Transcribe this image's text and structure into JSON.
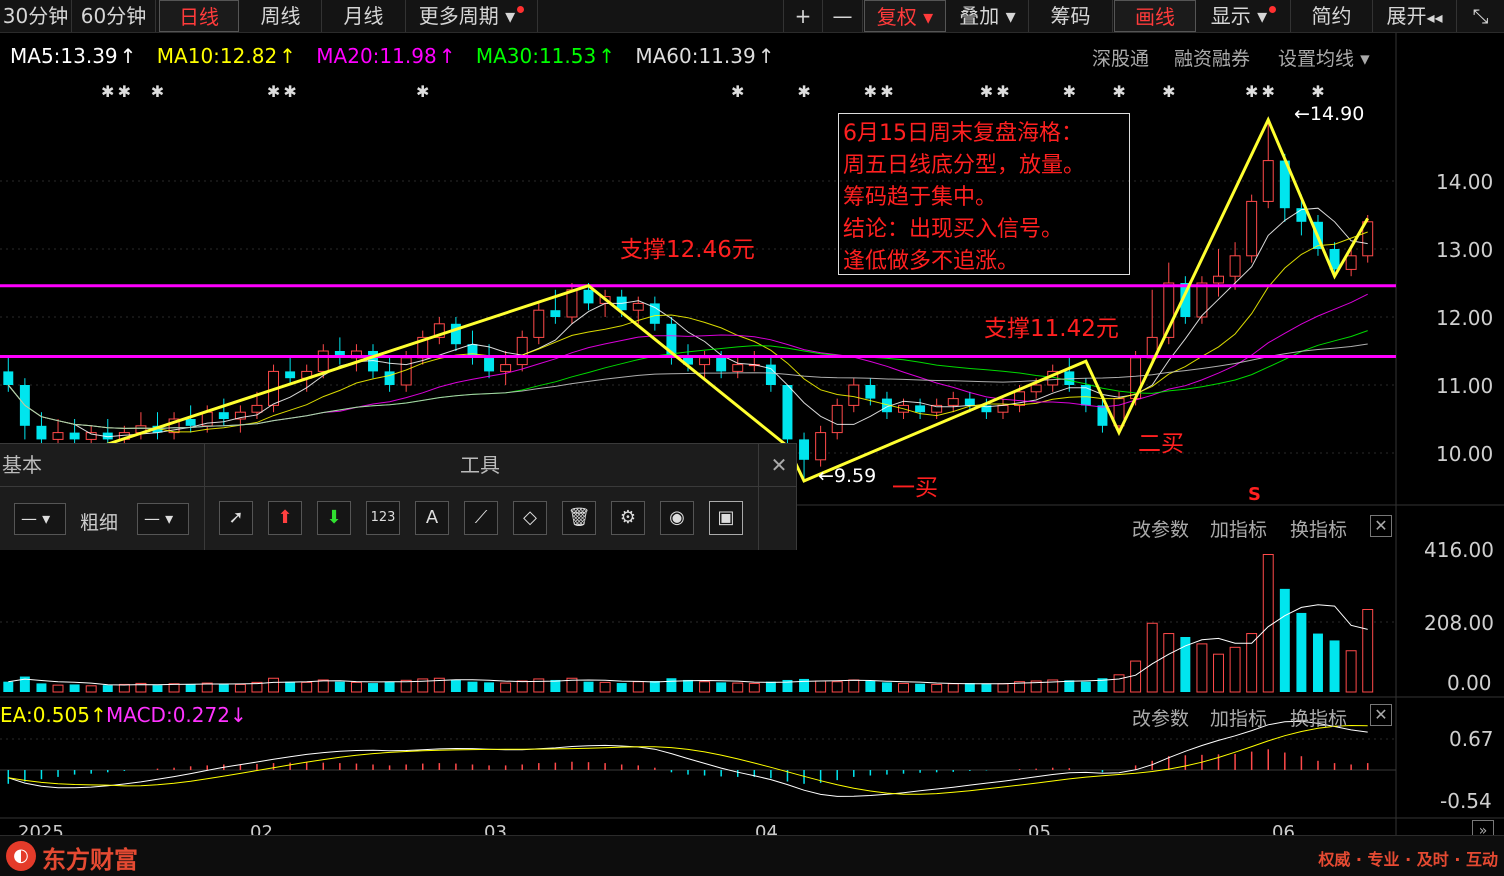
{
  "toolbar": {
    "periods": [
      "30分钟",
      "60分钟",
      "日线",
      "周线",
      "月线",
      "更多周期"
    ],
    "active_period": "日线",
    "right_buttons": [
      "+",
      "—",
      "复权",
      "叠加",
      "筹码",
      "画线",
      "显示",
      "简约",
      "展开"
    ],
    "restore_label": "复权",
    "draw_label": "画线"
  },
  "ma_indicators": [
    {
      "label": "MA5:13.39",
      "color": "#ffffff"
    },
    {
      "label": "MA10:12.82",
      "color": "#ffff00"
    },
    {
      "label": "MA20:11.98",
      "color": "#ff00ff"
    },
    {
      "label": "MA30:11.53",
      "color": "#00ff00"
    },
    {
      "label": "MA60:11.39",
      "color": "#dddddd"
    }
  ],
  "right_links": {
    "sgt": "深股通",
    "margin": "融资融券",
    "set_ma": "设置均线"
  },
  "annotations": {
    "note_lines": [
      "6月15日周末复盘海格：",
      "周五日线底分型，放量。",
      "筹码趋于集中。",
      "结论：出现买入信号。",
      "逢低做多不追涨。"
    ],
    "support1": "支撑12.46元",
    "support2": "支撑11.42元",
    "high_label": "14.90",
    "low_label": "9.59",
    "buy1": "一买",
    "buy2": "二买",
    "s_mark": "S"
  },
  "price_axis": [
    "14.00",
    "13.00",
    "12.00",
    "11.00",
    "10.00"
  ],
  "volume_axis": [
    "416.00",
    "208.00",
    "0.00"
  ],
  "macd_axis": [
    "0.67",
    "-0.54"
  ],
  "sub_panel_links": {
    "change_param": "改参数",
    "add_indicator": "加指标",
    "switch_indicator": "换指标"
  },
  "macd_labels": {
    "dea": "EA:0.505",
    "macd": "MACD:0.272"
  },
  "x_axis": [
    "2025",
    "02",
    "03",
    "04",
    "05",
    "06"
  ],
  "draw_panel": {
    "basic": "基本",
    "tools": "工具",
    "thickness": "粗细",
    "tool_icons": [
      "pointer-icon",
      "up-arrow-icon",
      "down-arrow-icon",
      "number-icon",
      "text-icon",
      "ruler-icon",
      "eraser-icon",
      "trash-icon",
      "gear-icon",
      "eye-icon",
      "image-icon"
    ]
  },
  "footer": {
    "brand": "东方财富",
    "slogan": "权威 · 专业 · 及时 · 互动"
  },
  "chart_data": {
    "type": "candlestick",
    "price_range": [
      9.4,
      15.2
    ],
    "support_levels": [
      12.46,
      11.42
    ],
    "key_points": {
      "high": 14.9,
      "low": 9.59
    },
    "candles": [
      [
        11.2,
        11.4,
        10.9,
        11.0
      ],
      [
        11.0,
        11.1,
        10.2,
        10.4
      ],
      [
        10.4,
        10.6,
        10.0,
        10.2
      ],
      [
        10.2,
        10.5,
        10.0,
        10.3
      ],
      [
        10.3,
        10.5,
        10.1,
        10.2
      ],
      [
        10.2,
        10.4,
        10.0,
        10.3
      ],
      [
        10.3,
        10.5,
        10.1,
        10.2
      ],
      [
        10.2,
        10.4,
        10.1,
        10.3
      ],
      [
        10.3,
        10.6,
        10.2,
        10.4
      ],
      [
        10.4,
        10.6,
        10.2,
        10.3
      ],
      [
        10.3,
        10.6,
        10.2,
        10.5
      ],
      [
        10.5,
        10.7,
        10.3,
        10.4
      ],
      [
        10.4,
        10.7,
        10.3,
        10.6
      ],
      [
        10.6,
        10.8,
        10.4,
        10.5
      ],
      [
        10.5,
        10.7,
        10.3,
        10.6
      ],
      [
        10.6,
        10.9,
        10.5,
        10.7
      ],
      [
        10.7,
        11.3,
        10.6,
        11.2
      ],
      [
        11.2,
        11.4,
        11.0,
        11.1
      ],
      [
        11.1,
        11.3,
        10.9,
        11.2
      ],
      [
        11.2,
        11.6,
        11.1,
        11.5
      ],
      [
        11.5,
        11.7,
        11.3,
        11.4
      ],
      [
        11.4,
        11.6,
        11.2,
        11.5
      ],
      [
        11.5,
        11.6,
        11.1,
        11.2
      ],
      [
        11.2,
        11.4,
        10.9,
        11.0
      ],
      [
        11.0,
        11.5,
        10.9,
        11.4
      ],
      [
        11.4,
        11.8,
        11.3,
        11.7
      ],
      [
        11.7,
        12.0,
        11.6,
        11.9
      ],
      [
        11.9,
        12.0,
        11.5,
        11.6
      ],
      [
        11.6,
        11.8,
        11.3,
        11.4
      ],
      [
        11.4,
        11.6,
        11.1,
        11.2
      ],
      [
        11.2,
        11.5,
        11.0,
        11.3
      ],
      [
        11.3,
        11.8,
        11.2,
        11.7
      ],
      [
        11.7,
        12.2,
        11.6,
        12.1
      ],
      [
        12.1,
        12.4,
        11.9,
        12.0
      ],
      [
        12.0,
        12.5,
        11.9,
        12.4
      ],
      [
        12.4,
        12.5,
        12.1,
        12.2
      ],
      [
        12.2,
        12.4,
        12.0,
        12.3
      ],
      [
        12.3,
        12.4,
        12.0,
        12.1
      ],
      [
        12.1,
        12.3,
        11.9,
        12.2
      ],
      [
        12.2,
        12.3,
        11.8,
        11.9
      ],
      [
        11.9,
        12.0,
        11.3,
        11.4
      ],
      [
        11.4,
        11.6,
        11.2,
        11.3
      ],
      [
        11.3,
        11.5,
        11.1,
        11.4
      ],
      [
        11.4,
        11.5,
        11.1,
        11.2
      ],
      [
        11.2,
        11.4,
        11.1,
        11.3
      ],
      [
        11.3,
        11.5,
        11.2,
        11.3
      ],
      [
        11.3,
        11.4,
        10.9,
        11.0
      ],
      [
        11.0,
        11.0,
        10.1,
        10.2
      ],
      [
        10.2,
        10.3,
        9.59,
        9.9
      ],
      [
        9.9,
        10.4,
        9.8,
        10.3
      ],
      [
        10.3,
        10.8,
        10.2,
        10.7
      ],
      [
        10.7,
        11.1,
        10.6,
        11.0
      ],
      [
        11.0,
        11.1,
        10.7,
        10.8
      ],
      [
        10.8,
        10.9,
        10.5,
        10.6
      ],
      [
        10.6,
        10.8,
        10.5,
        10.7
      ],
      [
        10.7,
        10.8,
        10.5,
        10.6
      ],
      [
        10.6,
        10.8,
        10.5,
        10.7
      ],
      [
        10.7,
        10.9,
        10.6,
        10.8
      ],
      [
        10.8,
        10.9,
        10.6,
        10.7
      ],
      [
        10.7,
        10.8,
        10.5,
        10.6
      ],
      [
        10.6,
        10.8,
        10.5,
        10.7
      ],
      [
        10.7,
        11.0,
        10.6,
        10.9
      ],
      [
        10.9,
        11.1,
        10.8,
        11.0
      ],
      [
        11.0,
        11.3,
        10.9,
        11.2
      ],
      [
        11.2,
        11.4,
        10.9,
        11.0
      ],
      [
        11.0,
        11.1,
        10.6,
        10.7
      ],
      [
        10.7,
        10.8,
        10.3,
        10.4
      ],
      [
        10.4,
        10.9,
        10.3,
        10.8
      ],
      [
        10.8,
        11.5,
        10.7,
        11.4
      ],
      [
        11.4,
        12.4,
        11.3,
        11.7
      ],
      [
        11.7,
        12.8,
        11.6,
        12.5
      ],
      [
        12.5,
        12.6,
        11.9,
        12.0
      ],
      [
        12.0,
        12.6,
        11.9,
        12.5
      ],
      [
        12.5,
        13.0,
        12.3,
        12.6
      ],
      [
        12.6,
        13.1,
        12.4,
        12.9
      ],
      [
        12.9,
        13.8,
        12.8,
        13.7
      ],
      [
        13.7,
        14.9,
        13.6,
        14.3
      ],
      [
        14.3,
        14.4,
        13.4,
        13.6
      ],
      [
        13.6,
        13.8,
        13.2,
        13.4
      ],
      [
        13.4,
        13.5,
        12.9,
        13.0
      ],
      [
        13.0,
        13.1,
        12.6,
        12.7
      ],
      [
        12.7,
        13.0,
        12.6,
        12.9
      ],
      [
        12.9,
        13.5,
        12.8,
        13.4
      ]
    ],
    "volume": [
      30,
      45,
      25,
      20,
      22,
      18,
      20,
      22,
      25,
      20,
      24,
      22,
      26,
      24,
      22,
      28,
      40,
      30,
      28,
      35,
      30,
      28,
      26,
      30,
      34,
      38,
      40,
      35,
      30,
      28,
      26,
      32,
      38,
      35,
      40,
      30,
      28,
      26,
      30,
      32,
      40,
      35,
      30,
      28,
      26,
      25,
      30,
      35,
      38,
      32,
      30,
      35,
      32,
      28,
      25,
      24,
      22,
      24,
      26,
      25,
      24,
      30,
      32,
      35,
      34,
      30,
      40,
      50,
      90,
      200,
      170,
      160,
      140,
      110,
      130,
      170,
      400,
      300,
      230,
      170,
      150,
      120,
      240
    ],
    "macd_hist": [
      -0.3,
      -0.25,
      -0.2,
      -0.15,
      -0.1,
      -0.08,
      -0.05,
      -0.02,
      0,
      0.03,
      0.05,
      0.08,
      0.1,
      0.12,
      0.12,
      0.13,
      0.15,
      0.16,
      0.17,
      0.16,
      0.15,
      0.14,
      0.12,
      0.1,
      0.12,
      0.14,
      0.15,
      0.14,
      0.12,
      0.1,
      0.1,
      0.12,
      0.15,
      0.16,
      0.18,
      0.17,
      0.15,
      0.12,
      0.1,
      0.05,
      -0.05,
      -0.1,
      -0.12,
      -0.14,
      -0.15,
      -0.15,
      -0.18,
      -0.25,
      -0.3,
      -0.28,
      -0.22,
      -0.15,
      -0.12,
      -0.1,
      -0.08,
      -0.06,
      -0.05,
      -0.04,
      -0.02,
      -0.01,
      0,
      0.02,
      0.03,
      0.05,
      0.04,
      0.0,
      -0.05,
      0.0,
      0.1,
      0.2,
      0.3,
      0.32,
      0.33,
      0.34,
      0.35,
      0.4,
      0.45,
      0.38,
      0.3,
      0.2,
      0.15,
      0.12,
      0.15
    ],
    "x_labels": [
      "2025",
      "02",
      "03",
      "04",
      "05",
      "06"
    ]
  }
}
